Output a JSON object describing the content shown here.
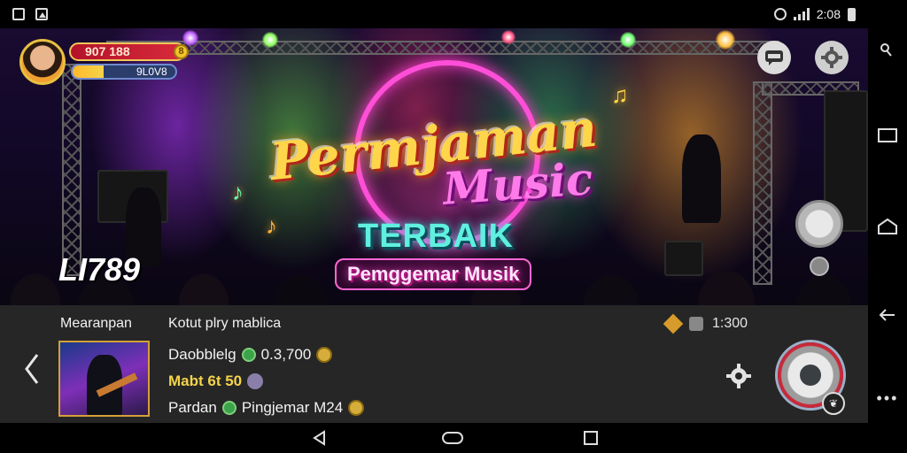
{
  "status_bar": {
    "time": "2:08"
  },
  "profile": {
    "score": "907 188",
    "coin_symbol": "8",
    "level_label": "9L0V8",
    "level_progress": 0.3
  },
  "logo": {
    "title_line1": "Permjaman",
    "title_line2": "Music",
    "subtitle": "TERBAIK",
    "tagline": "Pemggemar Musik"
  },
  "watermark": "LI789",
  "panel": {
    "title": "Mearanpan",
    "subtitle": "Kotut plry mablica",
    "rows": [
      {
        "name": "Daobblelg",
        "value": "0.3,700"
      },
      {
        "name": "Mabt 6t 50",
        "value": ""
      },
      {
        "name": "Pardan",
        "value": "Pingjemar M24"
      }
    ],
    "status_value": "1:300"
  },
  "colors": {
    "panel_bg": "#262626",
    "accent_gold": "#f4d34a",
    "score_red": "#d92a3c",
    "level_blue": "#2b3d6b",
    "record_red": "#c8293a"
  },
  "icons": {
    "status_left": [
      "square-notification-icon",
      "image-notification-icon"
    ],
    "status_right": [
      "clock-icon",
      "signal-icon",
      "battery-icon"
    ],
    "stage_top_right": [
      "chat-icon",
      "settings-cog-icon"
    ],
    "panel": [
      "back-arrow-icon",
      "gold-tag-icon",
      "grey-box-icon",
      "gear-icon",
      "record-icon"
    ],
    "system_nav_right": [
      "key-icon",
      "recent-apps-icon",
      "home-icon",
      "back-icon",
      "more-icon"
    ],
    "system_nav_bottom": [
      "back-triangle-icon",
      "home-pill-icon",
      "recent-square-icon"
    ]
  }
}
